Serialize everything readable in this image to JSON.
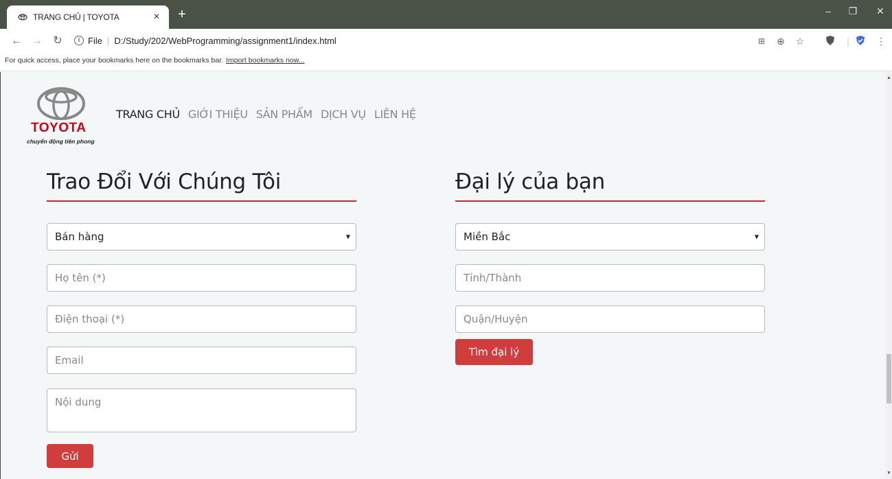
{
  "browser": {
    "tab_title": "TRANG CHỦ | TOYOTA",
    "tab_close": "×",
    "new_tab": "+",
    "window_controls": [
      "–",
      "❐",
      "✕"
    ],
    "address_scheme": "File",
    "address_url": "D:/Study/202/WebProgramming/assignment1/index.html",
    "bookmarks_text": "For quick access, place your bookmarks here on the bookmarks bar.",
    "bookmarks_link": "Import bookmarks now..."
  },
  "header": {
    "logo_word": "TOYOTA",
    "logo_slogan": "chuyển động tiên phong",
    "nav": [
      "TRANG CHỦ",
      "GIỚI THIỆU",
      "SẢN PHẨM",
      "DỊCH VỤ",
      "LIÊN HỆ"
    ]
  },
  "contact_form": {
    "title": "Trao Đổi Với Chúng Tôi",
    "department_selected": "Bán hàng",
    "name_placeholder": "Họ tên (*)",
    "phone_placeholder": "Điện thoại (*)",
    "email_placeholder": "Email",
    "message_placeholder": "Nội dung",
    "submit_label": "Gửi"
  },
  "dealer_form": {
    "title": "Đại lý của bạn",
    "region_selected": "Miền Bắc",
    "province_placeholder": "Tỉnh/Thành",
    "district_placeholder": "Quận/Huyện",
    "search_label": "Tìm đại lý"
  },
  "colors": {
    "accent": "#d13c3c",
    "rule": "#c8282d",
    "page_bg": "#f3f7f7",
    "chrome_bg": "#4a5248"
  }
}
